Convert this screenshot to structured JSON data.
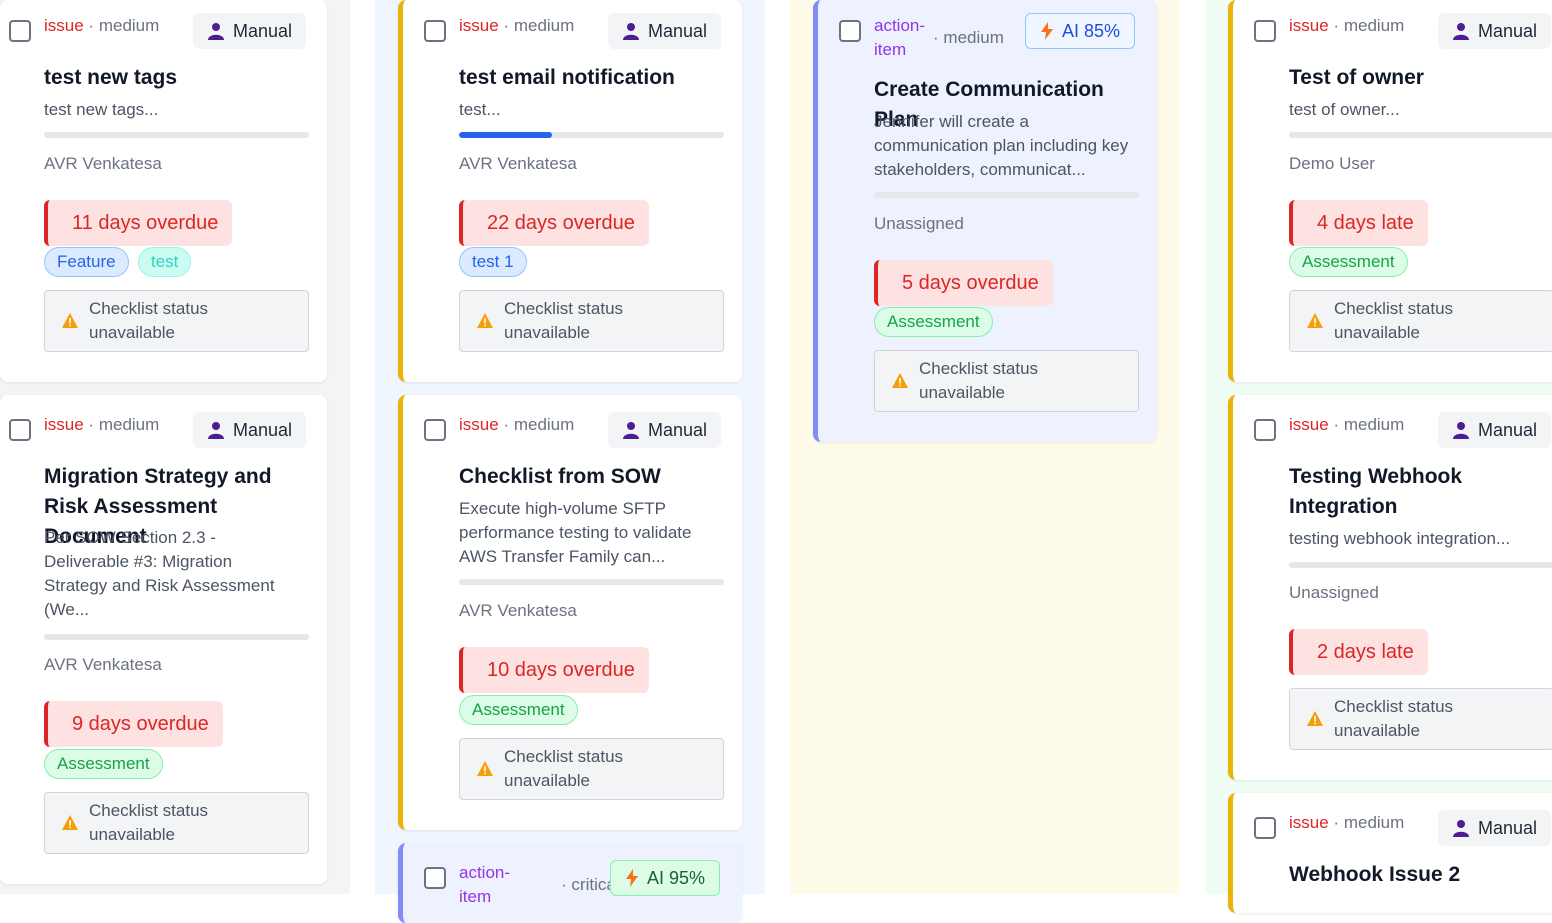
{
  "columns": [
    {
      "cards": [
        {
          "kind": "issue",
          "priority": "medium",
          "source": "Manual",
          "title": "test new tags",
          "desc": "test new tags...",
          "assignee": "AVR Venkatesa",
          "due": "11 days overdue",
          "tags": [
            "Feature",
            "test"
          ],
          "checklist": "Checklist status unavailable"
        },
        {
          "kind": "issue",
          "priority": "medium",
          "source": "Manual",
          "title": "Migration Strategy and Risk Assessment Document",
          "desc": "Per SOW Section 2.3 - Deliverable #3: Migration Strategy and Risk Assessment (We...",
          "assignee": "AVR Venkatesa",
          "due": "9 days overdue",
          "tags": [
            "Assessment"
          ],
          "checklist": "Checklist status unavailable"
        }
      ]
    },
    {
      "cards": [
        {
          "kind": "issue",
          "priority": "medium",
          "source": "Manual",
          "title": "test email notification",
          "desc": "test...",
          "progress": 0.35,
          "assignee": "AVR Venkatesa",
          "due": "22 days overdue",
          "tags": [
            "test 1"
          ],
          "checklist": "Checklist status unavailable"
        },
        {
          "kind": "issue",
          "priority": "medium",
          "source": "Manual",
          "title": "Checklist from SOW",
          "desc": "Execute high-volume SFTP performance testing to validate AWS Transfer Family can...",
          "assignee": "AVR Venkatesa",
          "due": "10 days overdue",
          "tags": [
            "Assessment"
          ],
          "checklist": "Checklist status unavailable"
        },
        {
          "kind": "action-item",
          "priority": "critical",
          "source": "AI 95%"
        }
      ]
    },
    {
      "cards": [
        {
          "kind": "action-item",
          "priority": "medium",
          "source": "AI 85%",
          "title": "Create Communication Plan",
          "desc": "Jennifer will create a communication plan including key stakeholders, communicat...",
          "assignee": "Unassigned",
          "due": "5 days overdue",
          "tags": [
            "Assessment"
          ],
          "checklist": "Checklist status unavailable"
        }
      ]
    },
    {
      "cards": [
        {
          "kind": "issue",
          "priority": "medium",
          "source": "Manual",
          "title": "Test of owner",
          "desc": "test of owner...",
          "assignee": "Demo User",
          "due": "4 days late",
          "tags": [
            "Assessment"
          ],
          "checklist": "Checklist status unavailable"
        },
        {
          "kind": "issue",
          "priority": "medium",
          "source": "Manual",
          "title": "Testing Webhook Integration",
          "desc": "testing webhook integration...",
          "assignee": "Unassigned",
          "due": "2 days late",
          "checklist": "Checklist status unavailable"
        },
        {
          "kind": "issue",
          "priority": "medium",
          "source": "Manual",
          "title": "Webhook Issue 2"
        }
      ]
    }
  ],
  "labels": {
    "sep": "·"
  },
  "colors": {
    "overdue": "#dc2626",
    "accent_yellow": "#eab308",
    "accent_purple": "#818cf8",
    "progress": "#2563eb"
  },
  "icons": {
    "manual": "person-icon",
    "ai": "bolt-icon",
    "checklist": "warning-icon"
  }
}
